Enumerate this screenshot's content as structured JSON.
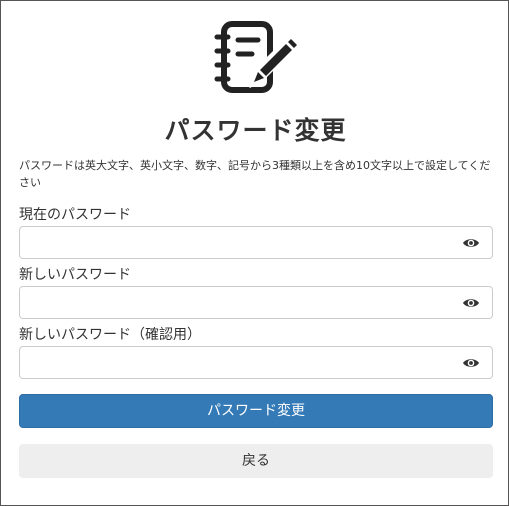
{
  "header": {
    "logo_icon": "notebook-pen-icon",
    "title": "パスワード変更"
  },
  "instructions": "パスワードは英大文字、英小文字、数字、記号から3種類以上を含め10文字以上で設定してください",
  "form": {
    "fields": [
      {
        "label": "現在のパスワード",
        "value": "",
        "placeholder": "",
        "toggle_icon": "eye-icon"
      },
      {
        "label": "新しいパスワード",
        "value": "",
        "placeholder": "",
        "toggle_icon": "eye-icon"
      },
      {
        "label": "新しいパスワード（確認用）",
        "value": "",
        "placeholder": "",
        "toggle_icon": "eye-icon"
      }
    ],
    "submit_label": "パスワード変更",
    "back_label": "戻る"
  },
  "colors": {
    "primary": "#337ab7",
    "secondary": "#eeeeee",
    "text": "#333333",
    "border": "#cccccc"
  }
}
